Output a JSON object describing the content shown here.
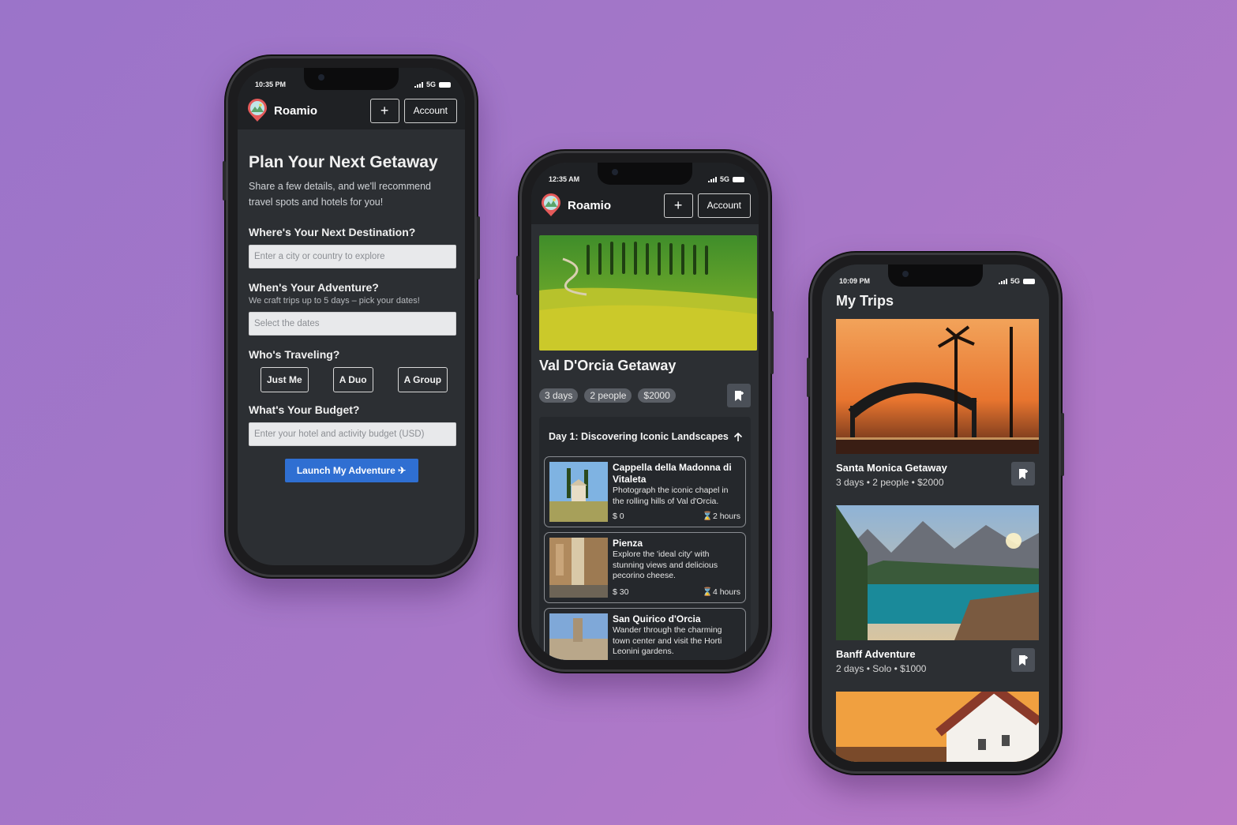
{
  "brand": "Roamio",
  "header": {
    "add_label": "+",
    "account_label": "Account"
  },
  "plan_screen": {
    "status_time": "10:35 PM",
    "network": "5G",
    "title": "Plan Your Next Getaway",
    "subtitle": "Share a few details, and we'll recommend travel spots and hotels for you!",
    "destination_label": "Where's Your Next Destination?",
    "destination_placeholder": "Enter a city or country to explore",
    "dates_label": "When's Your Adventure?",
    "dates_hint": "We craft trips up to 5 days – pick your dates!",
    "dates_placeholder": "Select the dates",
    "travelers_label": "Who's Traveling?",
    "travelers": [
      "Just Me",
      "A Duo",
      "A Group"
    ],
    "budget_label": "What's Your Budget?",
    "budget_placeholder": "Enter your hotel and activity budget (USD)",
    "launch_label": "Launch My Adventure ✈"
  },
  "trip_screen": {
    "status_time": "12:35 AM",
    "network": "5G",
    "title": "Val D'Orcia Getaway",
    "chips": [
      "3 days",
      "2 people",
      "$2000"
    ],
    "day_title": "Day 1: Discovering Iconic Landscapes",
    "activities": [
      {
        "name": "Cappella della Madonna di Vitaleta",
        "desc": "Photograph the iconic chapel in the rolling hills of Val d'Orcia.",
        "cost": "$ 0",
        "duration": "⌛2 hours"
      },
      {
        "name": "Pienza",
        "desc": "Explore the 'ideal city' with stunning views and delicious pecorino cheese.",
        "cost": "$ 30",
        "duration": "⌛4 hours"
      },
      {
        "name": "San Quirico d'Orcia",
        "desc": "Wander through the charming town center and visit the Horti Leonini gardens.",
        "cost": "",
        "duration": ""
      }
    ]
  },
  "my_trips_screen": {
    "status_time": "10:09 PM",
    "network": "5G",
    "title": "My Trips",
    "trips": [
      {
        "name": "Santa Monica Getaway",
        "meta": "3 days • 2 people • $2000"
      },
      {
        "name": "Banff Adventure",
        "meta": "2 days • Solo • $1000"
      }
    ]
  },
  "colors": {
    "accent": "#2f6fd2",
    "surface": "#2c2f33",
    "bar": "#1f2124"
  }
}
